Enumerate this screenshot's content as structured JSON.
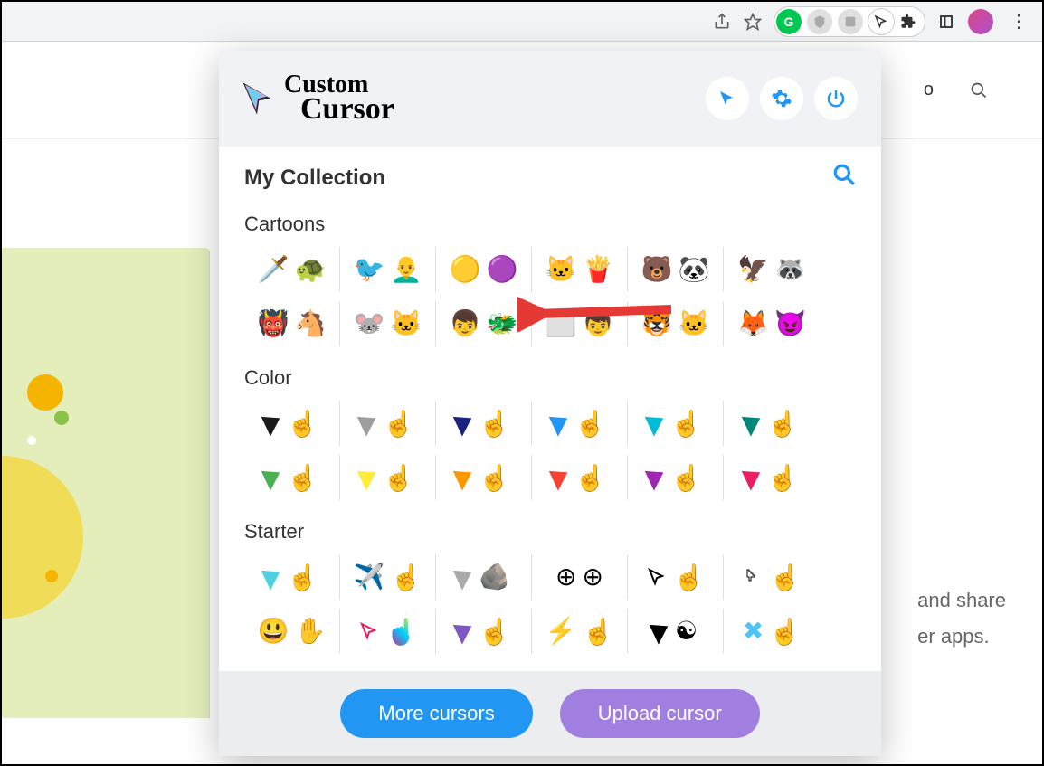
{
  "browser": {
    "share_icon": "share-icon",
    "star_icon": "star-icon",
    "extensions": [
      "grammarly",
      "privacy",
      "toggle",
      "cursor",
      "puzzle"
    ],
    "window_icon": "window-icon",
    "menu_icon": "menu-icon"
  },
  "background_page": {
    "nav_right": "o",
    "text_line1": "and share",
    "text_line2": "er apps."
  },
  "popup": {
    "logo": {
      "line1": "Custom",
      "line2": "Cursor"
    },
    "header_buttons": {
      "cursor": "cursor-button",
      "settings": "settings-button",
      "power": "power-button"
    },
    "collection_title": "My Collection",
    "categories": [
      {
        "name": "Cartoons",
        "rows": [
          [
            {
              "a": "🗡️",
              "b": "🐢"
            },
            {
              "a": "🐦",
              "b": "👨‍🦲"
            },
            {
              "a": "🟡",
              "b": "🟣"
            },
            {
              "a": "🐱",
              "b": "🍟"
            },
            {
              "a": "🐻",
              "b": "🐼"
            },
            {
              "a": "🦅",
              "b": "🦝"
            }
          ],
          [
            {
              "a": "👹",
              "b": "🐴"
            },
            {
              "a": "🐭",
              "b": "🐱"
            },
            {
              "a": "👦",
              "b": "🐲"
            },
            {
              "a": "⬜",
              "b": "👦"
            },
            {
              "a": "🐯",
              "b": "🐱"
            },
            {
              "a": "🦊",
              "b": "😈"
            }
          ]
        ]
      },
      {
        "name": "Color",
        "rows": [
          [
            {
              "arrow": "#1a1a1a",
              "hand": "#1a1a1a"
            },
            {
              "arrow": "#9e9e9e",
              "hand": "#9e9e9e"
            },
            {
              "arrow": "#1a237e",
              "hand": "#1a237e"
            },
            {
              "arrow": "#2196f3",
              "hand": "#2196f3"
            },
            {
              "arrow": "#00bcd4",
              "hand": "#00bcd4"
            },
            {
              "arrow": "#00897b",
              "hand": "#00897b"
            }
          ],
          [
            {
              "arrow": "#4caf50",
              "hand": "#4caf50"
            },
            {
              "arrow": "#ffeb3b",
              "hand": "#ffeb3b"
            },
            {
              "arrow": "#ff9800",
              "hand": "#ff9800"
            },
            {
              "arrow": "#f44336",
              "hand": "#f44336"
            },
            {
              "arrow": "#9c27b0",
              "hand": "#9c27b0"
            },
            {
              "arrow": "#e91e63",
              "hand": "#e91e63"
            }
          ]
        ]
      },
      {
        "name": "Starter",
        "rows": [
          [
            {
              "special": "neon"
            },
            {
              "special": "paper"
            },
            {
              "special": "stone"
            },
            {
              "special": "crosshair"
            },
            {
              "special": "outline"
            },
            {
              "special": "pixel"
            }
          ],
          [
            {
              "special": "emoji"
            },
            {
              "special": "rainbow"
            },
            {
              "special": "holo"
            },
            {
              "special": "lightning"
            },
            {
              "special": "yin"
            },
            {
              "special": "pixelblue"
            }
          ]
        ]
      }
    ],
    "footer": {
      "more": "More cursors",
      "upload": "Upload cursor"
    }
  }
}
